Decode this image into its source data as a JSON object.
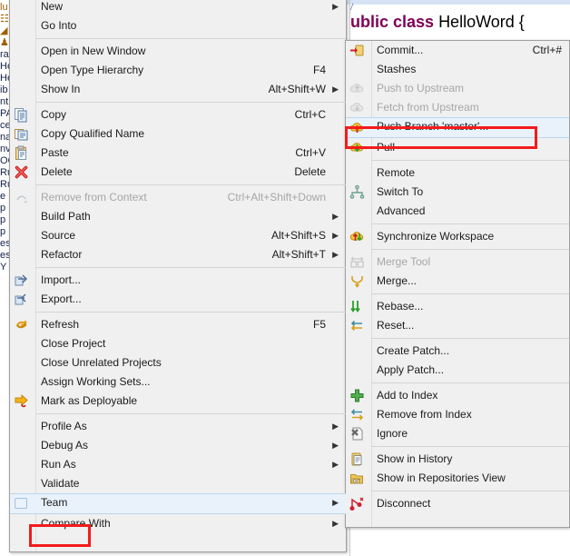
{
  "editor": {
    "line1": "/",
    "code_keyword": "ublic class ",
    "code_identifier": "HelloWord {"
  },
  "background_tree_fragments": [
    "lu",
    "☷",
    "◢",
    "",
    "♟",
    "ra",
    "He",
    "He",
    "ib",
    "nt",
    "PA",
    "ce",
    "na",
    "nv",
    "OC",
    "Ru",
    "Ru",
    "e",
    "p",
    "p",
    "p",
    "es",
    "es",
    "Y"
  ],
  "main_menu": {
    "name": "project-context-menu",
    "items": [
      {
        "label": "New",
        "accel": "",
        "arrow": true,
        "icon": "",
        "disabled": false
      },
      {
        "label": "Go Into",
        "accel": "",
        "arrow": false,
        "icon": "",
        "disabled": false
      },
      {
        "separator": true
      },
      {
        "label": "Open in New Window",
        "accel": "",
        "arrow": false,
        "icon": "",
        "disabled": false
      },
      {
        "label": "Open Type Hierarchy",
        "accel": "F4",
        "arrow": false,
        "icon": "",
        "disabled": false
      },
      {
        "label": "Show In",
        "accel": "Alt+Shift+W",
        "arrow": true,
        "icon": "",
        "disabled": false
      },
      {
        "separator": true
      },
      {
        "label": "Copy",
        "accel": "Ctrl+C",
        "arrow": false,
        "icon": "copy-icon",
        "disabled": false
      },
      {
        "label": "Copy Qualified Name",
        "accel": "",
        "arrow": false,
        "icon": "copy-qualified-icon",
        "disabled": false
      },
      {
        "label": "Paste",
        "accel": "Ctrl+V",
        "arrow": false,
        "icon": "paste-icon",
        "disabled": false
      },
      {
        "label": "Delete",
        "accel": "Delete",
        "arrow": false,
        "icon": "delete-x-icon",
        "disabled": false
      },
      {
        "separator": true
      },
      {
        "label": "Remove from Context",
        "accel": "Ctrl+Alt+Shift+Down",
        "arrow": false,
        "icon": "remove-context-icon",
        "disabled": true
      },
      {
        "label": "Build Path",
        "accel": "",
        "arrow": true,
        "icon": "",
        "disabled": false
      },
      {
        "label": "Source",
        "accel": "Alt+Shift+S",
        "arrow": true,
        "icon": "",
        "disabled": false
      },
      {
        "label": "Refactor",
        "accel": "Alt+Shift+T",
        "arrow": true,
        "icon": "",
        "disabled": false
      },
      {
        "separator": true
      },
      {
        "label": "Import...",
        "accel": "",
        "arrow": false,
        "icon": "import-icon",
        "disabled": false
      },
      {
        "label": "Export...",
        "accel": "",
        "arrow": false,
        "icon": "export-icon",
        "disabled": false
      },
      {
        "separator": true
      },
      {
        "label": "Refresh",
        "accel": "F5",
        "arrow": false,
        "icon": "refresh-icon",
        "disabled": false
      },
      {
        "label": "Close Project",
        "accel": "",
        "arrow": false,
        "icon": "",
        "disabled": false
      },
      {
        "label": "Close Unrelated Projects",
        "accel": "",
        "arrow": false,
        "icon": "",
        "disabled": false
      },
      {
        "label": "Assign Working Sets...",
        "accel": "",
        "arrow": false,
        "icon": "",
        "disabled": false
      },
      {
        "label": "Mark as Deployable",
        "accel": "",
        "arrow": false,
        "icon": "deployable-arrow-icon",
        "disabled": false
      },
      {
        "separator": true
      },
      {
        "label": "Profile As",
        "accel": "",
        "arrow": true,
        "icon": "",
        "disabled": false
      },
      {
        "label": "Debug As",
        "accel": "",
        "arrow": true,
        "icon": "",
        "disabled": false
      },
      {
        "label": "Run As",
        "accel": "",
        "arrow": true,
        "icon": "",
        "disabled": false
      },
      {
        "label": "Validate",
        "accel": "",
        "arrow": false,
        "icon": "",
        "disabled": false
      },
      {
        "label": "Team",
        "accel": "",
        "arrow": true,
        "icon": "team-icon",
        "disabled": false,
        "highlighted": true
      },
      {
        "label": "Compare With",
        "accel": "",
        "arrow": true,
        "icon": "",
        "disabled": false
      }
    ]
  },
  "team_menu": {
    "name": "team-git-submenu",
    "items": [
      {
        "label": "Commit...",
        "accel": "Ctrl+#",
        "arrow": false,
        "icon": "commit-icon",
        "disabled": false
      },
      {
        "label": "Stashes",
        "accel": "",
        "arrow": false,
        "icon": "",
        "disabled": false
      },
      {
        "label": "Push to Upstream",
        "accel": "",
        "arrow": false,
        "icon": "push-upstream-icon",
        "disabled": true
      },
      {
        "label": "Fetch from Upstream",
        "accel": "",
        "arrow": false,
        "icon": "fetch-upstream-icon",
        "disabled": true
      },
      {
        "label": "Push Branch 'master'...",
        "accel": "",
        "arrow": false,
        "icon": "push-branch-icon",
        "disabled": false,
        "highlighted": true
      },
      {
        "label": "Pull",
        "accel": "",
        "arrow": false,
        "icon": "pull-icon",
        "disabled": false
      },
      {
        "separator": true
      },
      {
        "label": "Remote",
        "accel": "",
        "arrow": false,
        "icon": "",
        "disabled": false
      },
      {
        "label": "Switch To",
        "accel": "",
        "arrow": false,
        "icon": "switch-to-icon",
        "disabled": false
      },
      {
        "label": "Advanced",
        "accel": "",
        "arrow": false,
        "icon": "",
        "disabled": false
      },
      {
        "separator": true
      },
      {
        "label": "Synchronize Workspace",
        "accel": "",
        "arrow": false,
        "icon": "synchronize-icon",
        "disabled": false
      },
      {
        "separator": true
      },
      {
        "label": "Merge Tool",
        "accel": "",
        "arrow": false,
        "icon": "merge-tool-icon",
        "disabled": true
      },
      {
        "label": "Merge...",
        "accel": "",
        "arrow": false,
        "icon": "merge-icon",
        "disabled": false
      },
      {
        "separator": true
      },
      {
        "label": "Rebase...",
        "accel": "",
        "arrow": false,
        "icon": "rebase-icon",
        "disabled": false
      },
      {
        "label": "Reset...",
        "accel": "",
        "arrow": false,
        "icon": "reset-icon",
        "disabled": false
      },
      {
        "separator": true
      },
      {
        "label": "Create Patch...",
        "accel": "",
        "arrow": false,
        "icon": "",
        "disabled": false
      },
      {
        "label": "Apply Patch...",
        "accel": "",
        "arrow": false,
        "icon": "",
        "disabled": false
      },
      {
        "separator": true
      },
      {
        "label": "Add to Index",
        "accel": "",
        "arrow": false,
        "icon": "add-index-icon",
        "disabled": false
      },
      {
        "label": "Remove from Index",
        "accel": "",
        "arrow": false,
        "icon": "remove-index-icon",
        "disabled": false
      },
      {
        "label": "Ignore",
        "accel": "",
        "arrow": false,
        "icon": "ignore-icon",
        "disabled": false
      },
      {
        "separator": true
      },
      {
        "label": "Show in History",
        "accel": "",
        "arrow": false,
        "icon": "history-icon",
        "disabled": false
      },
      {
        "label": "Show in Repositories View",
        "accel": "",
        "arrow": false,
        "icon": "repositories-icon",
        "disabled": false
      },
      {
        "separator": true
      },
      {
        "label": "Disconnect",
        "accel": "",
        "arrow": false,
        "icon": "disconnect-icon",
        "disabled": false
      }
    ]
  },
  "annotations": {
    "highlight_color": "#f41b1b",
    "boxes": [
      "push-branch-master-highlight",
      "team-highlight"
    ]
  }
}
